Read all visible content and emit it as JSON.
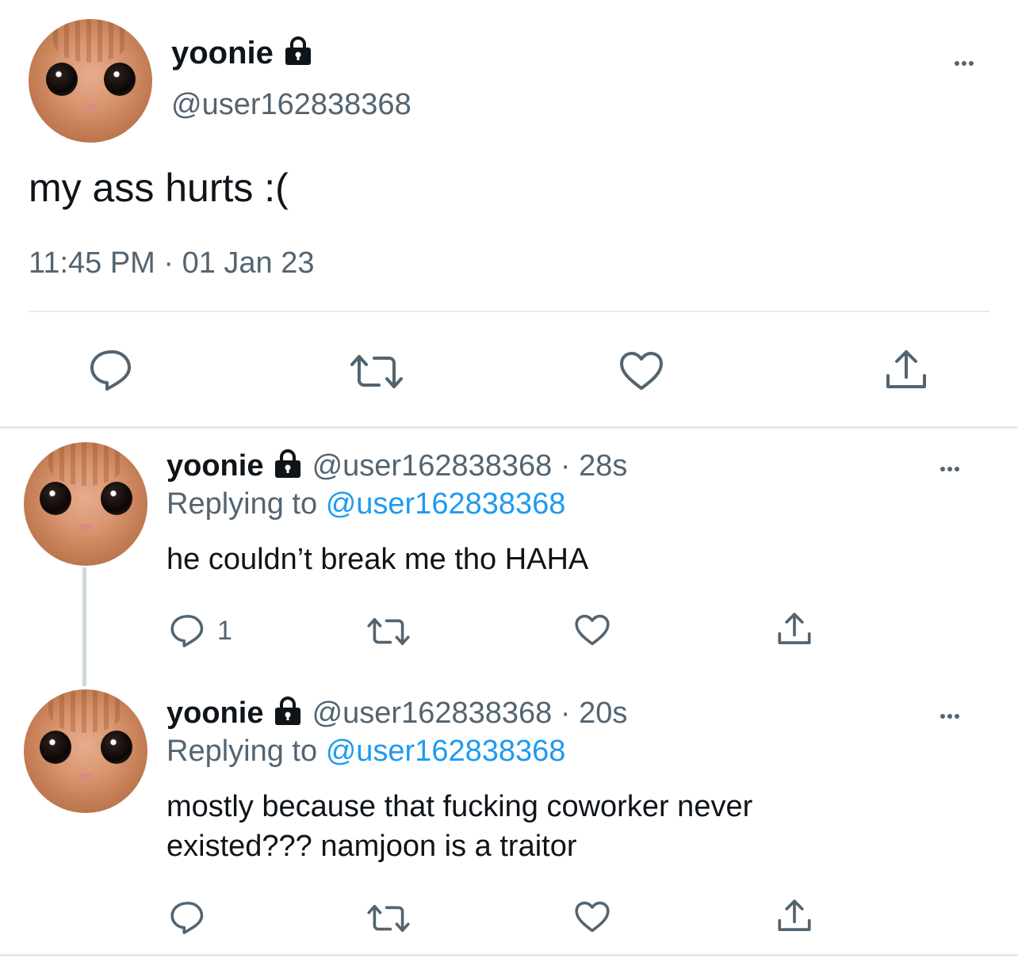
{
  "main_tweet": {
    "display_name": "yoonie",
    "handle": "@user162838368",
    "text": "my ass hurts :(",
    "timestamp": "11:45 PM · 01 Jan 23",
    "actions": [
      "reply-icon",
      "retweet-icon",
      "like-icon",
      "share-icon"
    ]
  },
  "replies": [
    {
      "display_name": "yoonie",
      "handle_time": "@user162838368 · 28s",
      "replying_prefix": "Replying to",
      "replying_to": "@user162838368",
      "text_lines": [
        "he couldn’t break me tho HAHA"
      ],
      "reply_count": "1"
    },
    {
      "display_name": "yoonie",
      "handle_time": "@user162838368 · 20s",
      "replying_prefix": "Replying to",
      "replying_to": "@user162838368",
      "text_lines": [
        "mostly because that fucking coworker never",
        "existed??? namjoon is a traitor"
      ],
      "reply_count": ""
    }
  ],
  "colors": {
    "primary_text": "#0f1419",
    "secondary_text": "#536471",
    "link": "#1d9bf0",
    "divider": "#e6e9eb"
  }
}
